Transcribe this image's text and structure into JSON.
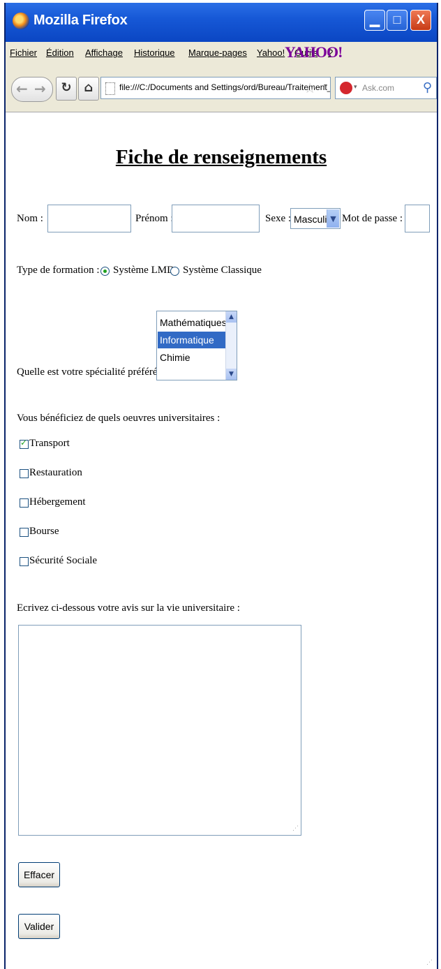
{
  "window": {
    "title": "Mozilla Firefox",
    "min_glyph": "▁",
    "max_glyph": "□",
    "close_glyph": "X"
  },
  "menu": {
    "items": [
      "Fichier",
      "Édition",
      "Affichage",
      "Historique",
      "Marque-pages",
      "Yahoo!",
      "Outils",
      "?"
    ],
    "yahoo_logo": "YAHOO!"
  },
  "nav": {
    "url": "file:///C:/Documents and Settings/ord/Bureau/Traitement_Texte",
    "search_placeholder": "Ask.com"
  },
  "form": {
    "title": "Fiche de renseignements",
    "nom_label": "Nom :",
    "nom_value": "",
    "prenom_label": "Prénom :",
    "prenom_value": "",
    "sexe_label": "Sexe :",
    "sexe_value": "Masculin",
    "password_label": "Mot de passe :",
    "password_value": "",
    "formation_label": "Type de formation :",
    "formation_options": [
      {
        "label": "Système LMD",
        "checked": true
      },
      {
        "label": "Système Classique",
        "checked": false
      }
    ],
    "specialite_label": "Quelle est votre spécialité préférée ?",
    "specialite_options": [
      "Mathématiques",
      "Informatique",
      "Chimie"
    ],
    "specialite_selected": "Informatique",
    "oeuvres_label": "Vous bénéficiez de quels oeuvres universitaires :",
    "oeuvres": [
      {
        "label": "Transport",
        "checked": true
      },
      {
        "label": "Restauration",
        "checked": false
      },
      {
        "label": "Hébergement",
        "checked": false
      },
      {
        "label": "Bourse",
        "checked": false
      },
      {
        "label": "Sécurité Sociale",
        "checked": false
      }
    ],
    "avis_label": "Ecrivez ci-dessous votre avis sur la vie universitaire :",
    "avis_value": "",
    "reset_label": "Effacer",
    "submit_label": "Valider"
  }
}
